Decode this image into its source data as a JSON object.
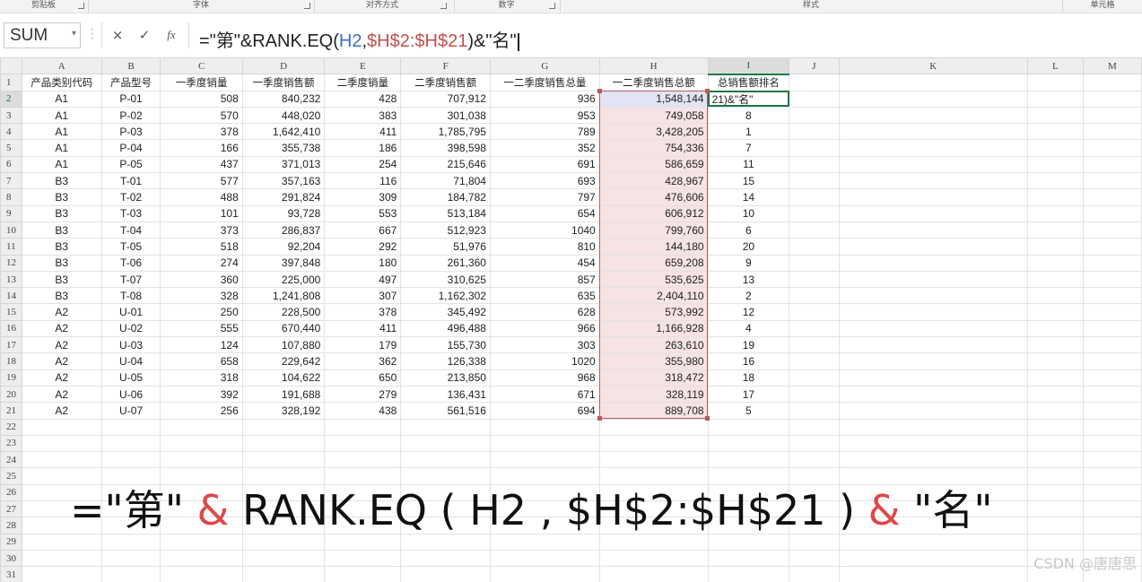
{
  "ribbon": {
    "groups": [
      "剪贴板",
      "字体",
      "对齐方式",
      "数字",
      "样式",
      "单元格"
    ]
  },
  "formula_bar": {
    "name_box": "SUM",
    "cancel_icon": "×",
    "enter_icon": "✓",
    "fx_label": "fx",
    "formula_parts": [
      "=\"第\"&RANK.EQ(",
      "H2",
      ",",
      "$H$2:$H$21",
      ")&\"名\""
    ]
  },
  "columns": [
    "A",
    "B",
    "C",
    "D",
    "E",
    "F",
    "G",
    "H",
    "I",
    "J",
    "K",
    "L",
    "M"
  ],
  "headers": [
    "产品类别代码",
    "产品型号",
    "一季度销量",
    "一季度销售额",
    "二季度销量",
    "二季度销售额",
    "一二季度销售总量",
    "一二季度销售总额",
    "总销售额排名"
  ],
  "rows": [
    [
      "A1",
      "P-01",
      "508",
      "840,232",
      "428",
      "707,912",
      "936",
      "1,548,144",
      "21)&\"名\""
    ],
    [
      "A1",
      "P-02",
      "570",
      "448,020",
      "383",
      "301,038",
      "953",
      "749,058",
      "8"
    ],
    [
      "A1",
      "P-03",
      "378",
      "1,642,410",
      "411",
      "1,785,795",
      "789",
      "3,428,205",
      "1"
    ],
    [
      "A1",
      "P-04",
      "166",
      "355,738",
      "186",
      "398,598",
      "352",
      "754,336",
      "7"
    ],
    [
      "A1",
      "P-05",
      "437",
      "371,013",
      "254",
      "215,646",
      "691",
      "586,659",
      "11"
    ],
    [
      "B3",
      "T-01",
      "577",
      "357,163",
      "116",
      "71,804",
      "693",
      "428,967",
      "15"
    ],
    [
      "B3",
      "T-02",
      "488",
      "291,824",
      "309",
      "184,782",
      "797",
      "476,606",
      "14"
    ],
    [
      "B3",
      "T-03",
      "101",
      "93,728",
      "553",
      "513,184",
      "654",
      "606,912",
      "10"
    ],
    [
      "B3",
      "T-04",
      "373",
      "286,837",
      "667",
      "512,923",
      "1040",
      "799,760",
      "6"
    ],
    [
      "B3",
      "T-05",
      "518",
      "92,204",
      "292",
      "51,976",
      "810",
      "144,180",
      "20"
    ],
    [
      "B3",
      "T-06",
      "274",
      "397,848",
      "180",
      "261,360",
      "454",
      "659,208",
      "9"
    ],
    [
      "B3",
      "T-07",
      "360",
      "225,000",
      "497",
      "310,625",
      "857",
      "535,625",
      "13"
    ],
    [
      "B3",
      "T-08",
      "328",
      "1,241,808",
      "307",
      "1,162,302",
      "635",
      "2,404,110",
      "2"
    ],
    [
      "A2",
      "U-01",
      "250",
      "228,500",
      "378",
      "345,492",
      "628",
      "573,992",
      "12"
    ],
    [
      "A2",
      "U-02",
      "555",
      "670,440",
      "411",
      "496,488",
      "966",
      "1,166,928",
      "4"
    ],
    [
      "A2",
      "U-03",
      "124",
      "107,880",
      "179",
      "155,730",
      "303",
      "263,610",
      "19"
    ],
    [
      "A2",
      "U-04",
      "658",
      "229,642",
      "362",
      "126,338",
      "1020",
      "355,980",
      "16"
    ],
    [
      "A2",
      "U-05",
      "318",
      "104,622",
      "650",
      "213,850",
      "968",
      "318,472",
      "18"
    ],
    [
      "A2",
      "U-06",
      "392",
      "191,688",
      "279",
      "136,431",
      "671",
      "328,119",
      "17"
    ],
    [
      "A2",
      "U-07",
      "256",
      "328,192",
      "438",
      "561,516",
      "694",
      "889,708",
      "5"
    ]
  ],
  "empty_row_numbers": [
    "22",
    "23",
    "24",
    "25",
    "26",
    "27",
    "28",
    "29",
    "30",
    "31"
  ],
  "caption": {
    "part1": "=\"第\"",
    "amp1": "&",
    "part2": "RANK.EQ ( H2 , $H$2:$H$21 )",
    "amp2": "&",
    "part3": "\"名\""
  },
  "watermark": "CSDN @唐唐思",
  "colors": {
    "accent_green": "#217346",
    "range_highlight": "#f6e3e3",
    "range_border": "#b65b60",
    "ref_blue": "#3a6fc4",
    "ref_red": "#c0504d",
    "caption_amp": "#e04848"
  }
}
